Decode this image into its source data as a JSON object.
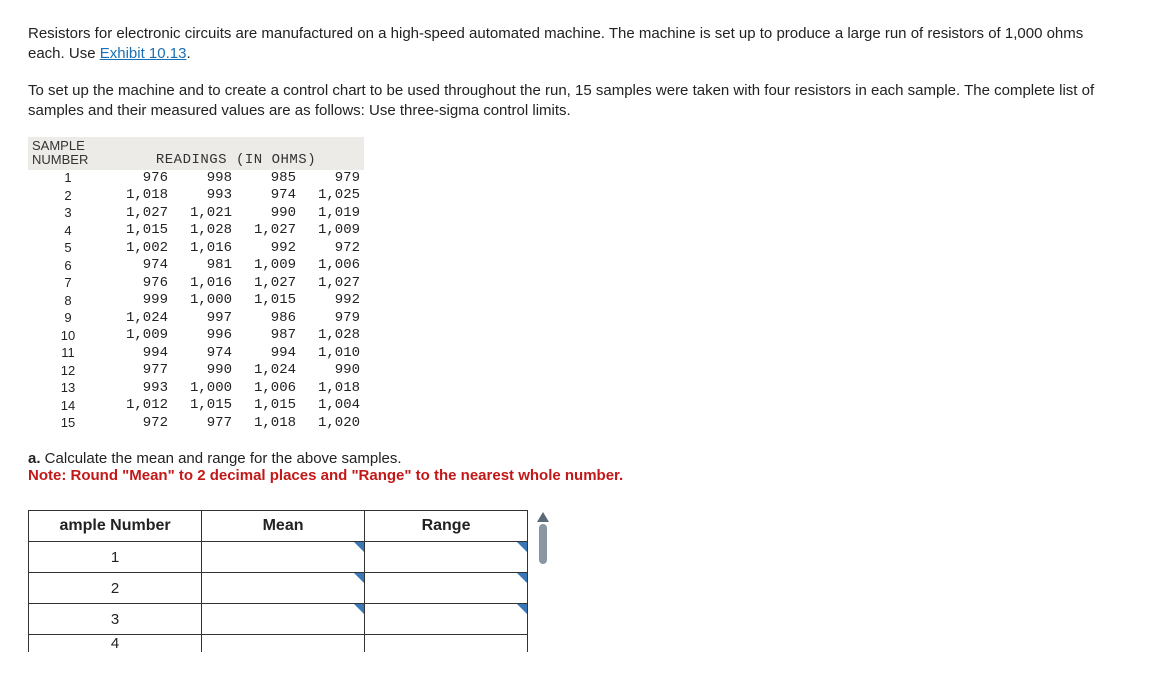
{
  "intro": {
    "p1_a": "Resistors for electronic circuits are manufactured on a high-speed automated machine. The machine is set up to produce a large run of resistors of 1,000 ohms each. Use ",
    "exhibit": "Exhibit 10.13",
    "p1_b": ".",
    "p2": "To set up the machine and to create a control chart to be used throughout the run, 15 samples were taken with four resistors in each sample. The complete list of samples and their measured values are as follows: Use three-sigma control limits."
  },
  "data_table": {
    "header_sample_l1": "SAMPLE",
    "header_sample_l2": "NUMBER",
    "header_readings": "READINGS (IN OHMS)",
    "rows": [
      {
        "n": "1",
        "r": [
          "976",
          "998",
          "985",
          "979"
        ]
      },
      {
        "n": "2",
        "r": [
          "1,018",
          "993",
          "974",
          "1,025"
        ]
      },
      {
        "n": "3",
        "r": [
          "1,027",
          "1,021",
          "990",
          "1,019"
        ]
      },
      {
        "n": "4",
        "r": [
          "1,015",
          "1,028",
          "1,027",
          "1,009"
        ]
      },
      {
        "n": "5",
        "r": [
          "1,002",
          "1,016",
          "992",
          "972"
        ]
      },
      {
        "n": "6",
        "r": [
          "974",
          "981",
          "1,009",
          "1,006"
        ]
      },
      {
        "n": "7",
        "r": [
          "976",
          "1,016",
          "1,027",
          "1,027"
        ]
      },
      {
        "n": "8",
        "r": [
          "999",
          "1,000",
          "1,015",
          "992"
        ]
      },
      {
        "n": "9",
        "r": [
          "1,024",
          "997",
          "986",
          "979"
        ]
      },
      {
        "n": "10",
        "r": [
          "1,009",
          "996",
          "987",
          "1,028"
        ]
      },
      {
        "n": "11",
        "r": [
          "994",
          "974",
          "994",
          "1,010"
        ]
      },
      {
        "n": "12",
        "r": [
          "977",
          "990",
          "1,024",
          "990"
        ]
      },
      {
        "n": "13",
        "r": [
          "993",
          "1,000",
          "1,006",
          "1,018"
        ]
      },
      {
        "n": "14",
        "r": [
          "1,012",
          "1,015",
          "1,015",
          "1,004"
        ]
      },
      {
        "n": "15",
        "r": [
          "972",
          "977",
          "1,018",
          "1,020"
        ]
      }
    ]
  },
  "part_a": {
    "label_prefix": "a.",
    "text": " Calculate the mean and range for the above samples.",
    "note": "Note: Round \"Mean\" to 2 decimal places and \"Range\" to the nearest whole number."
  },
  "answer_table": {
    "headers": {
      "sample": "Sample Number",
      "sample_visible": "ample Number",
      "mean": "Mean",
      "range": "Range"
    },
    "rows": [
      "1",
      "2",
      "3",
      "4"
    ]
  }
}
